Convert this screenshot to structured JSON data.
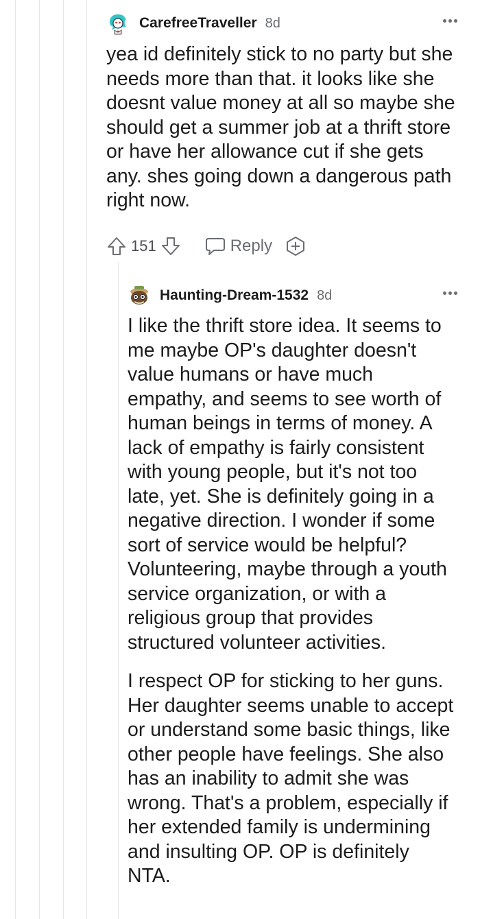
{
  "comments": [
    {
      "username": "CarefreeTraveller",
      "age": "8d",
      "paragraphs": [
        "yea id definitely stick to no party but she needs more than that. it looks like she doesnt value money at all so maybe she should get a summer job at a thrift store or have her allowance cut if she gets any. shes going down a dangerous path right now."
      ],
      "score": "151",
      "reply_label": "Reply"
    },
    {
      "username": "Haunting-Dream-1532",
      "age": "8d",
      "paragraphs": [
        "I like the thrift store idea. It seems to me maybe OP's daughter doesn't value humans or have much empathy, and seems to see worth of human beings in terms of money. A lack of empathy is fairly consistent with young people, but it's not too late, yet. She is definitely going in a negative direction. I wonder if some sort of service would be helpful? Volunteering, maybe through a youth service organization, or with a religious group that provides structured volunteer activities.",
        "I respect OP for sticking to her guns. Her daughter seems unable to accept or understand some basic things, like other people have feelings. She also has an inability to admit she was wrong. That's a problem, especially if her extended family is undermining and insulting OP. OP is definitely NTA."
      ]
    }
  ],
  "icons": {
    "upvote": "upvote-arrow-icon",
    "downvote": "downvote-arrow-icon",
    "reply": "comment-bubble-icon",
    "award": "add-award-icon",
    "more": "more-options-icon"
  },
  "colors": {
    "thread_line": "#e4e6e8",
    "meta_text": "#6a6e72",
    "body_text": "#1c1c1c"
  }
}
